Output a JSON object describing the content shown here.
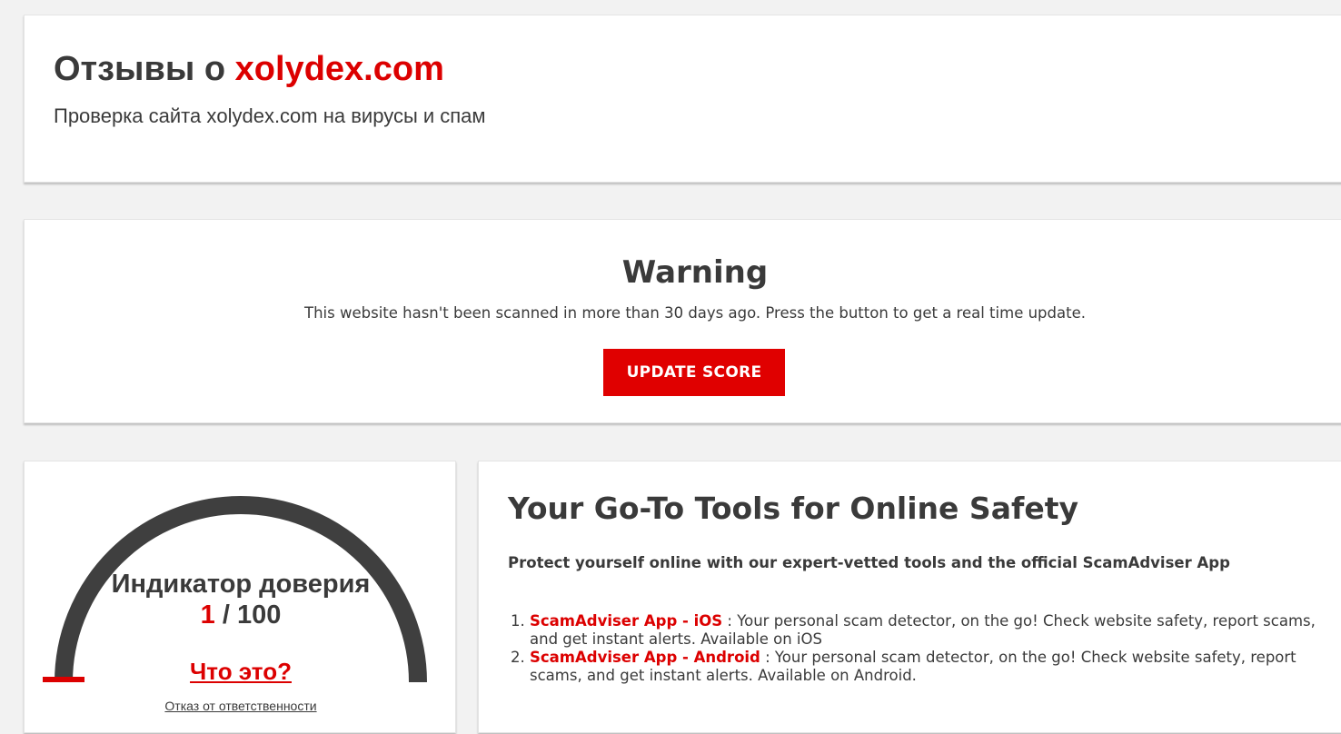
{
  "header": {
    "title_prefix": "Отзывы о ",
    "title_domain": "xolydex.com",
    "subtitle": "Проверка сайта xolydex.com на вирусы и спам"
  },
  "warning": {
    "title": "Warning",
    "text": "This website hasn't been scanned in more than 30 days ago. Press the button to get a real time update.",
    "button_label": "UPDATE SCORE"
  },
  "trust_score": {
    "label": "Индикатор доверия",
    "value": "1",
    "separator": " / ",
    "max": "100",
    "score_fraction": 0.01,
    "what_is_link": "Что это?",
    "disclaimer_link": "Отказ от ответственности"
  },
  "tools": {
    "title": "Your Go-To Tools for Online Safety",
    "intro": "Protect yourself online with our expert-vetted tools and the official ScamAdviser App",
    "items": [
      {
        "link": "ScamAdviser App - iOS",
        "text": " : Your personal scam detector, on the go! Check website safety, report scams, and get instant alerts. Available on iOS"
      },
      {
        "link": "ScamAdviser App - Android",
        "text": " : Your personal scam detector, on the go! Check website safety, report scams, and get instant alerts. Available on Android."
      }
    ]
  },
  "colors": {
    "accent": "#dc0000",
    "text": "#3a3a3a",
    "gauge": "#3f3f3f",
    "background": "#f2f2f2"
  }
}
